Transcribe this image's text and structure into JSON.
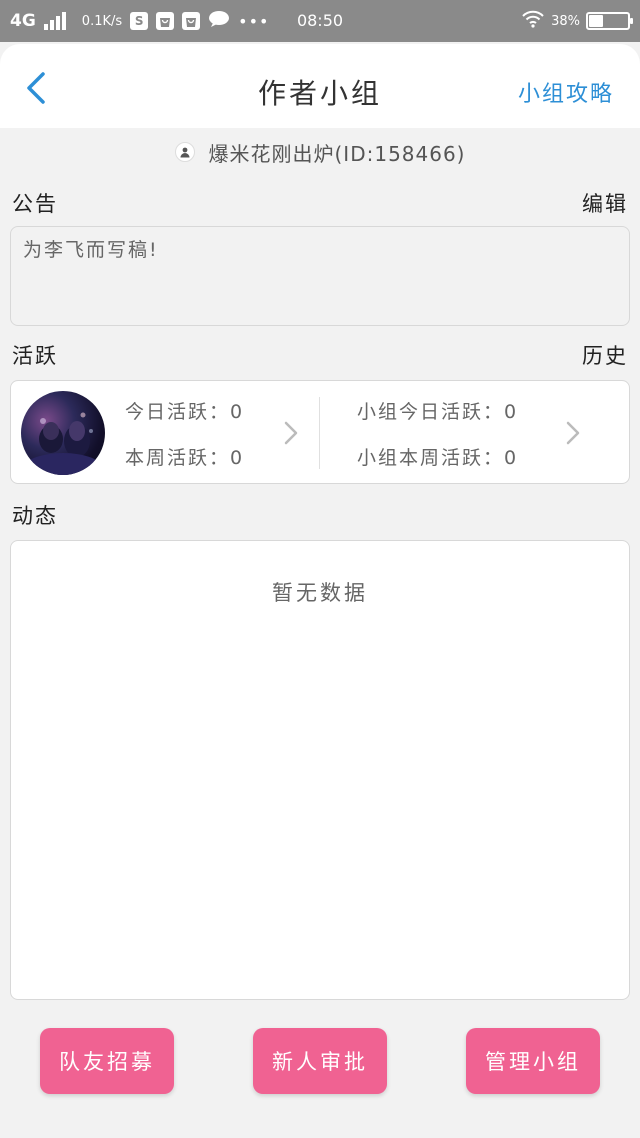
{
  "status_bar": {
    "network": "4G",
    "speed": "0.1K/s",
    "time": "08:50",
    "battery": "38%",
    "battery_level": 0.38,
    "app_icon_letter": "S",
    "more": "•••"
  },
  "header": {
    "title": "作者小组",
    "back_icon": "chevron-left-icon",
    "guide_link": "小组攻略"
  },
  "leader": {
    "name": "爆米花刚出炉(ID:158466)"
  },
  "notice": {
    "label": "公告",
    "action": "编辑",
    "content": "为李飞而写稿!"
  },
  "activity": {
    "label": "活跃",
    "action": "历史",
    "today": "今日活跃：0",
    "week": "本周活跃：0",
    "group_today": "小组今日活跃：0",
    "group_week": "小组本周活跃：0"
  },
  "feed": {
    "label": "动态",
    "empty": "暂无数据"
  },
  "buttons": {
    "recruit": "队友招募",
    "approve": "新人审批",
    "manage": "管理小组"
  },
  "colors": {
    "accent_blue": "#2d8fd6",
    "button_pink": "#f06292",
    "status_bar": "#8a8a8a"
  }
}
